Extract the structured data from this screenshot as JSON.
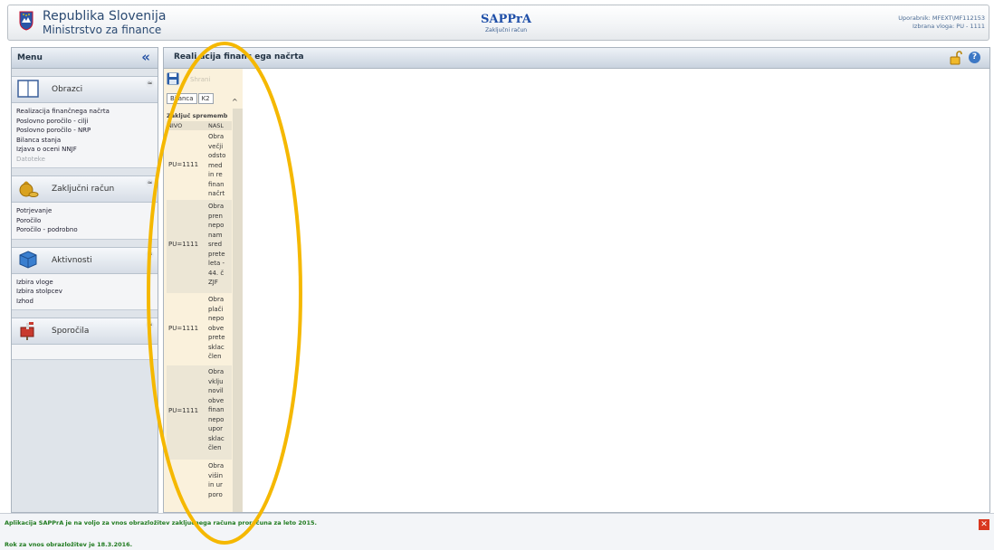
{
  "header": {
    "org_line1": "Republika Slovenija",
    "org_line2": "Ministrstvo za finance",
    "app_title": "SAPPrA",
    "app_subtitle": "Zaključni račun",
    "user_line": "Uporabnik: MFEXT\\MF112153",
    "role_line": "Izbrana vloga: PU - 1111"
  },
  "menu": {
    "title": "Menu",
    "collapse_icon": "double-chevron-left-icon",
    "sections": [
      {
        "label": "Obrazci",
        "icon": "form-icon",
        "toggle": "≈",
        "items": [
          "Realizacija finančnega načrta",
          "Poslovno poročilo - cilji",
          "Poslovno poročilo - NRP",
          "Bilanca stanja",
          "Izjava o oceni NNJF",
          "Datoteke"
        ]
      },
      {
        "label": "Zaključni račun",
        "icon": "money-bag-icon",
        "toggle": "≈",
        "items": [
          "Potrjevanje",
          "Poročilo",
          "Poročilo - podrobno"
        ]
      },
      {
        "label": "Aktivnosti",
        "icon": "cube-icon",
        "toggle": "≈",
        "items": [
          "Izbira vloge",
          "Izbira stolpcev",
          "Izhod"
        ]
      },
      {
        "label": "Sporočila",
        "icon": "mailbox-icon",
        "toggle": "≈",
        "items": []
      }
    ]
  },
  "main": {
    "title": "Reali acija financ ega načrta",
    "save_label": "Shrani",
    "tabs": [
      "Bilanca",
      "K2"
    ],
    "table_title": "Zaključ sprememb",
    "columns": [
      "NIVO",
      "NASL"
    ],
    "rows": [
      {
        "nivo": "PU=1111",
        "text": [
          "Obra",
          "večji",
          "odsto",
          "med",
          "in re",
          "finan",
          "načrt"
        ]
      },
      {
        "nivo": "PU=1111",
        "text": [
          "Obra",
          "pren",
          "nepo",
          "nam",
          "sred",
          "prete",
          "leta -",
          "44. č",
          "ZJF"
        ]
      },
      {
        "nivo": "PU=1111",
        "text": [
          "Obra",
          "plači",
          "nepo",
          "obve",
          "prete",
          "sklac",
          "člen"
        ]
      },
      {
        "nivo": "PU=1111",
        "text": [
          "Obra",
          "vklju",
          "novil",
          "obve",
          "finan",
          "nepo",
          "upor",
          "sklac",
          "člen"
        ]
      },
      {
        "nivo": "",
        "text": [
          "Obra",
          "višin",
          "in ur",
          "poro"
        ]
      }
    ]
  },
  "footer": {
    "notice1": "Aplikacija SAPPrA je na voljo za vnos obrazložitev zaključnega računa proračuna za leto 2015.",
    "notice2": "Rok za vnos obrazložitev je 18.3.2016.",
    "close_icon": "close-icon"
  },
  "colors": {
    "accent": "#2653a5",
    "highlight_ellipse": "#f5b800",
    "notice_text": "#1f7a1f",
    "column_bg": "#faf1dc"
  }
}
